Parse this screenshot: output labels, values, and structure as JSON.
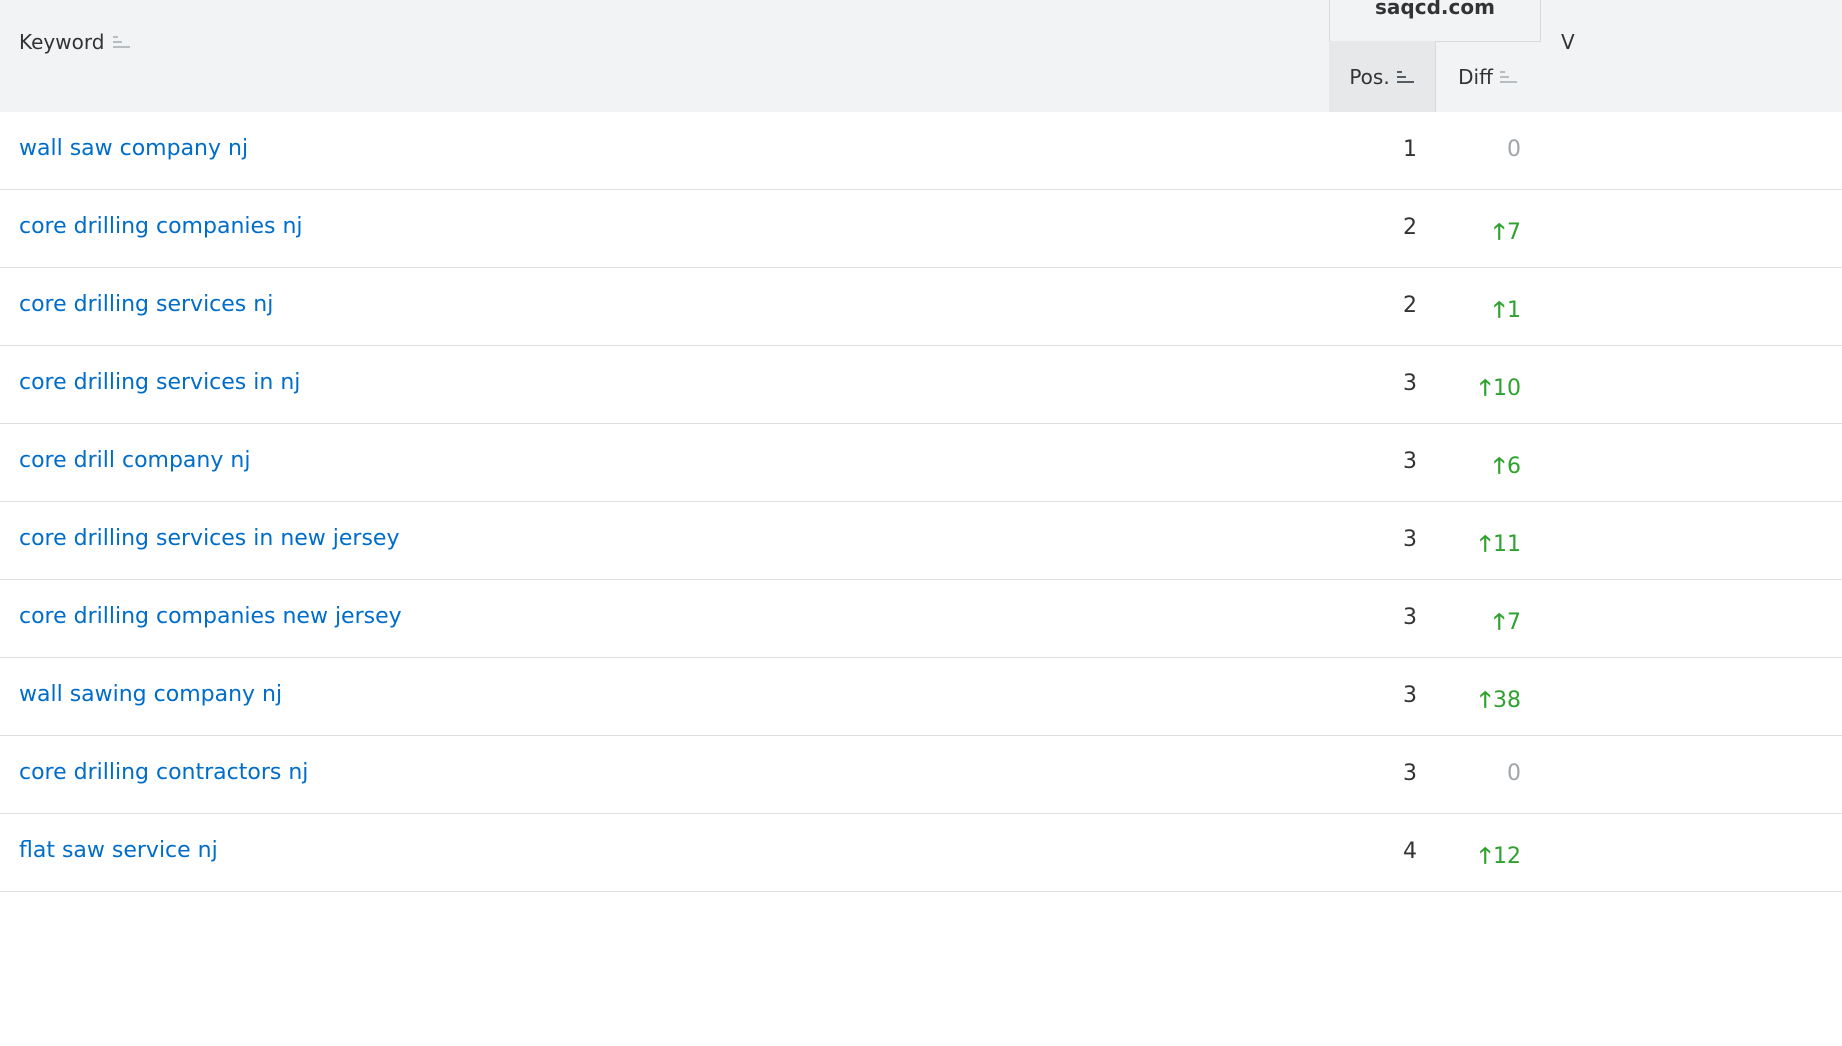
{
  "header": {
    "keyword_label": "Keyword",
    "domain": "saqcd.com",
    "pos_label": "Pos.",
    "diff_label": "Diff",
    "clipped_label": "V"
  },
  "colors": {
    "link": "#006dca",
    "up": "#2fa12f",
    "neutral": "#a0a5aa",
    "header_bg": "#f2f3f5"
  },
  "icons": {
    "sort": "sort-bars-icon",
    "up": "arrow-up-icon"
  },
  "rows": [
    {
      "keyword": "wall saw company nj",
      "pos": "1",
      "diff": "0",
      "trend": "none"
    },
    {
      "keyword": "core drilling companies nj",
      "pos": "2",
      "diff": "7",
      "trend": "up"
    },
    {
      "keyword": "core drilling services nj",
      "pos": "2",
      "diff": "1",
      "trend": "up"
    },
    {
      "keyword": "core drilling services in nj",
      "pos": "3",
      "diff": "10",
      "trend": "up"
    },
    {
      "keyword": "core drill company nj",
      "pos": "3",
      "diff": "6",
      "trend": "up"
    },
    {
      "keyword": "core drilling services in new jersey",
      "pos": "3",
      "diff": "11",
      "trend": "up"
    },
    {
      "keyword": "core drilling companies new jersey",
      "pos": "3",
      "diff": "7",
      "trend": "up"
    },
    {
      "keyword": "wall sawing company nj",
      "pos": "3",
      "diff": "38",
      "trend": "up"
    },
    {
      "keyword": "core drilling contractors nj",
      "pos": "3",
      "diff": "0",
      "trend": "none"
    },
    {
      "keyword": "flat saw service nj",
      "pos": "4",
      "diff": "12",
      "trend": "up"
    }
  ]
}
